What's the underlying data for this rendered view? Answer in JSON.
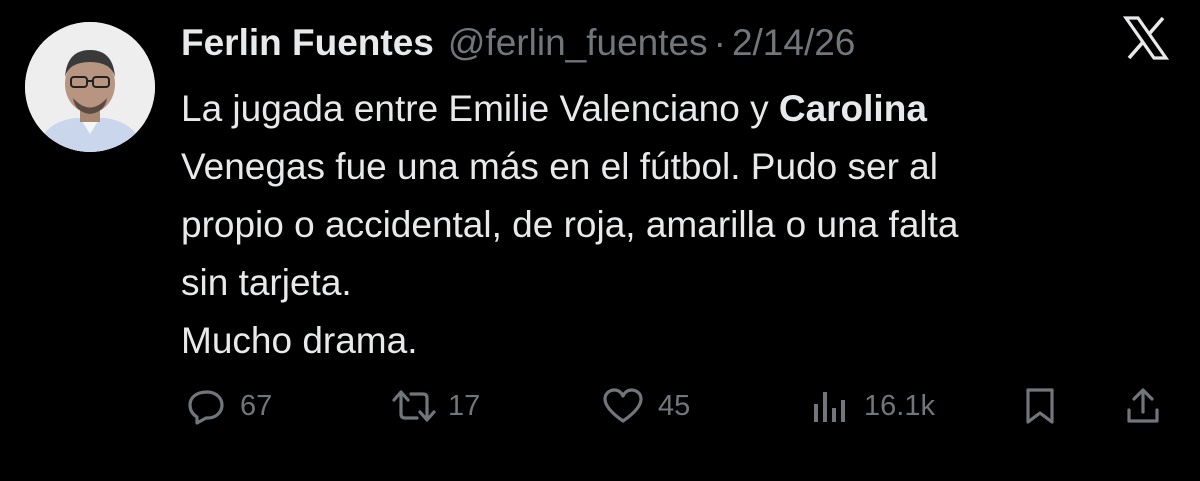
{
  "tweet": {
    "author_name": "Ferlin Fuentes",
    "handle": "@ferlin_fuentes",
    "separator": "·",
    "date": "2/14/26",
    "text_before_bold": "La jugada entre Emilie Valenciano y ",
    "text_bold": "Carolina",
    "text_after_bold": "\nVenegas fue una más en el fútbol. Pudo ser al\npropio o accidental,  de roja, amarilla o una falta\nsin tarjeta.\nMucho drama."
  },
  "actions": {
    "replies": "67",
    "reposts": "17",
    "likes": "45",
    "views": "16.1k"
  },
  "colors": {
    "background": "#000000",
    "text": "#e7e9ea",
    "muted": "#71767b"
  },
  "icons": [
    "avatar-photo",
    "x-logo-icon",
    "reply-icon",
    "repost-icon",
    "like-icon",
    "views-icon",
    "bookmark-icon",
    "share-icon"
  ]
}
